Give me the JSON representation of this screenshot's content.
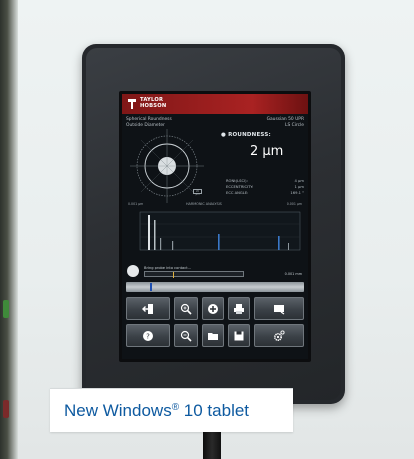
{
  "brand": {
    "line1": "TAYLOR",
    "line2": "HOBSON"
  },
  "header": {
    "left_line1": "Spherical Roundness",
    "left_line2": "Outside Diameter",
    "right_line1": "Gaussian 50 UPR",
    "right_line2": "LS Circle"
  },
  "result": {
    "label": "ROUNDNESS:",
    "value": "2 μm"
  },
  "params": [
    {
      "name": "RONt(LSCI):",
      "value": "4 μm"
    },
    {
      "name": "ECCENTRICITY:",
      "value": "1 μm"
    },
    {
      "name": "ECC ANGLE:",
      "value": "169.1 °"
    }
  ],
  "polar_scale": "20 μm",
  "histogram": {
    "title": "HARMONIC ANALYSIS",
    "left_label": "0.001 μm",
    "right_label": "0.001 μm"
  },
  "status": {
    "message": "Bring probe into contact...",
    "value": "0.001 mm"
  },
  "buttons": [
    {
      "name": "exit-button",
      "icon": "exit-icon"
    },
    {
      "name": "zoom-in-button",
      "icon": "zoom-in-icon"
    },
    {
      "name": "add-button",
      "icon": "add-icon"
    },
    {
      "name": "print-button",
      "icon": "print-icon"
    },
    {
      "name": "chart-button",
      "icon": "chart-icon"
    },
    {
      "name": "help-button",
      "icon": "help-icon"
    },
    {
      "name": "zoom-out-button",
      "icon": "zoom-out-icon"
    },
    {
      "name": "open-folder-button",
      "icon": "folder-icon"
    },
    {
      "name": "save-button",
      "icon": "save-icon"
    },
    {
      "name": "settings-button",
      "icon": "gear-icon"
    }
  ],
  "caption": {
    "prefix": "New Windows",
    "mark": "®",
    "suffix": " 10 tablet"
  },
  "colors": {
    "caption_text": "#0e5aa0",
    "brand_red": "#a92222",
    "frame": "#25282c"
  }
}
